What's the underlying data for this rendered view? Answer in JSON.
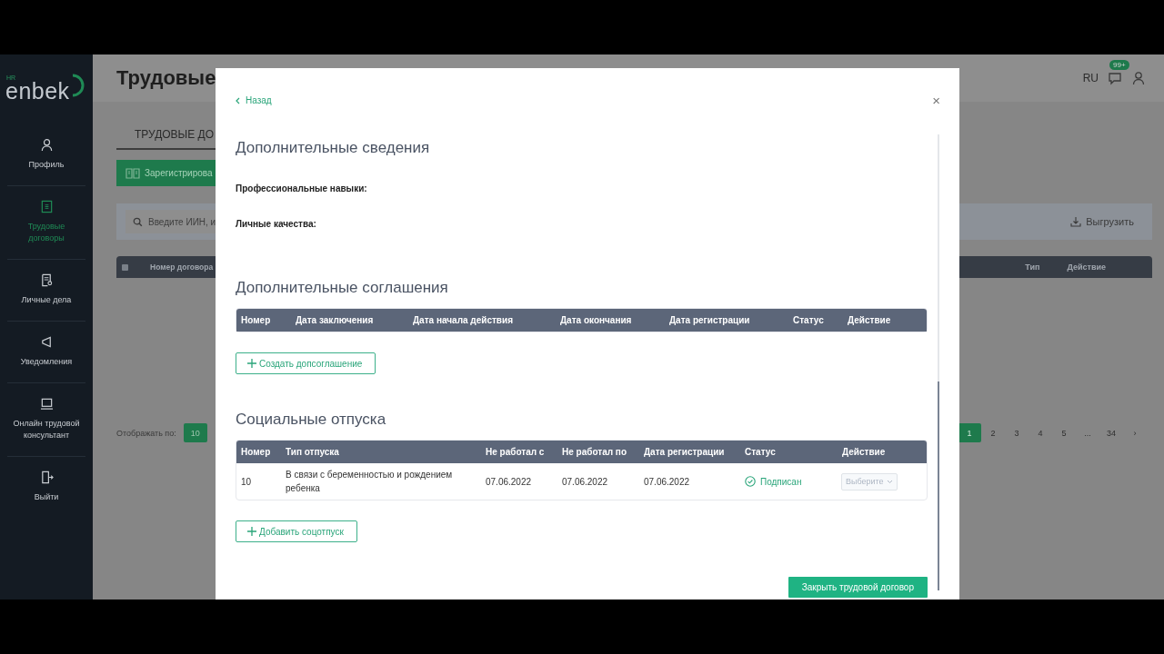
{
  "sidebar": {
    "logo_tag": "HR",
    "logo": "enbek",
    "items": [
      {
        "label": "Профиль",
        "selected": false
      },
      {
        "label": "Трудовые договоры",
        "selected": true
      },
      {
        "label": "Личные дела",
        "selected": false
      },
      {
        "label": "Уведомления",
        "selected": false
      },
      {
        "label": "Онлайн трудовой консультант",
        "selected": false
      },
      {
        "label": "Выйти",
        "selected": false
      }
    ]
  },
  "page": {
    "title": "Трудовые",
    "language": "RU",
    "notifications_badge": "99+",
    "tabs": [
      {
        "label": "ТРУДОВЫЕ ДО",
        "selected": true
      }
    ],
    "register_button": "Зарегистрирова",
    "search": {
      "placeholder": "Введите ИИН, и"
    },
    "export_button": "Выгрузить",
    "table": {
      "select_all_checked": false,
      "columns_left": [
        "Номер договора"
      ],
      "columns_right": [
        "Тип",
        "Действие"
      ]
    },
    "pagination": {
      "page_size_label": "Отображать по:",
      "page_size": "10",
      "pages": [
        {
          "label": "1",
          "selected": true
        },
        {
          "label": "2",
          "selected": false
        },
        {
          "label": "3",
          "selected": false
        },
        {
          "label": "4",
          "selected": false
        },
        {
          "label": "5",
          "selected": false
        },
        {
          "label": "...",
          "selected": false
        },
        {
          "label": "34",
          "selected": false
        }
      ],
      "next": "›"
    }
  },
  "modal": {
    "back": "Назад",
    "close": "×",
    "additional_info": {
      "title": "Дополнительные сведения",
      "fields": [
        "Профессиональные навыки:",
        "Личные качества:"
      ]
    },
    "agreements": {
      "title": "Дополнительные соглашения",
      "columns": [
        "Номер",
        "Дата заключения",
        "Дата начала действия",
        "Дата окончания",
        "Дата регистрации",
        "Статус",
        "Действие"
      ],
      "add_button": "Создать допсоглашение"
    },
    "social_leaves": {
      "title": "Социальные отпуска",
      "columns": [
        "Номер",
        "Тип отпуска",
        "Не работал с",
        "Не работал по",
        "Дата регистрации",
        "Статус",
        "Действие"
      ],
      "rows": [
        {
          "number": "10",
          "type": "В связи с беременностью и рождением ребенка",
          "from": "07.06.2022",
          "to": "07.06.2022",
          "registered": "07.06.2022",
          "status": {
            "label": "Подписан",
            "kind": "signed"
          },
          "action": {
            "placeholder": "Выберите",
            "disabled": true
          }
        }
      ],
      "add_button": "Добавить соцотпуск"
    },
    "footer_button": "Закрыть трудовой договор"
  }
}
